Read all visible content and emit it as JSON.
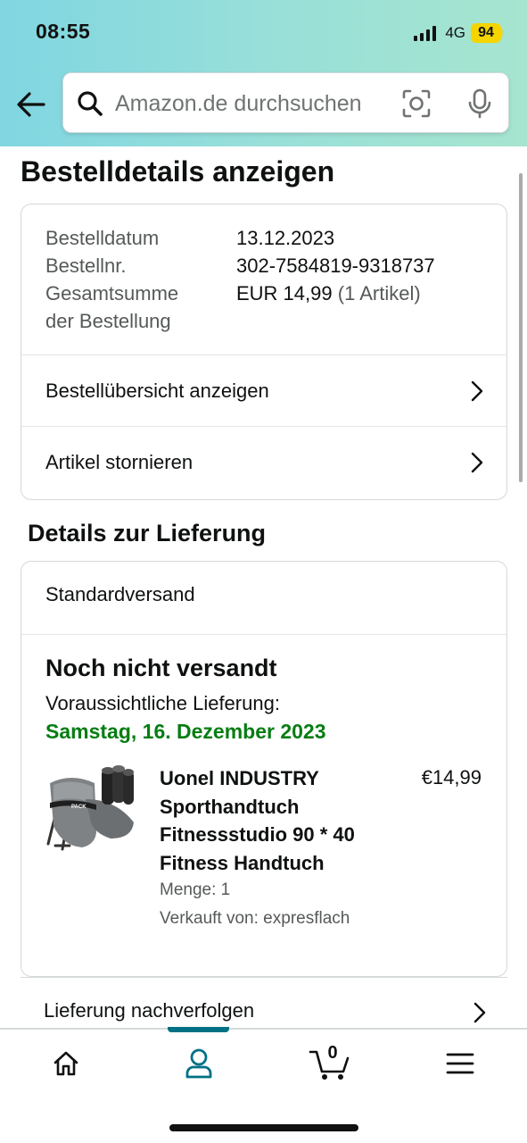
{
  "status_bar": {
    "time": "08:55",
    "network": "4G",
    "battery": "94",
    "battery_color": "#f5d400"
  },
  "search": {
    "placeholder": "Amazon.de durchsuchen",
    "icons": [
      "back-arrow-icon",
      "search-icon",
      "camera-icon",
      "mic-icon"
    ]
  },
  "page": {
    "title": "Bestelldetails anzeigen"
  },
  "order": {
    "date_label": "Bestelldatum",
    "date_value": "13.12.2023",
    "number_label": "Bestellnr.",
    "number_value": "302-7584819-9318737",
    "total_label_line1": "Gesamtsumme",
    "total_label_line2": "der Bestellung",
    "total_value": "EUR 14,99",
    "total_items": "(1 Artikel)",
    "links": [
      {
        "label": "Bestellübersicht anzeigen"
      },
      {
        "label": "Artikel stornieren"
      }
    ]
  },
  "delivery": {
    "section_title": "Details zur Lieferung",
    "method": "Standardversand",
    "status": "Noch nicht versandt",
    "expected_label": "Voraussichtliche Lieferung:",
    "expected_date": "Samstag, 16. Dezember 2023",
    "expected_date_color": "#067d12",
    "product": {
      "title": "Uonel INDUSTRY Sporthandtuch Fitnessstudio 90 * 40 Fitness Handtuch",
      "price": "€14,99",
      "quantity": "Menge: 1",
      "seller": "Verkauft von: expresflach",
      "image_brand_text": "PACK"
    },
    "track_label": "Lieferung nachverfolgen"
  },
  "bottom_nav": {
    "items": [
      {
        "name": "home",
        "icon": "home-icon"
      },
      {
        "name": "account",
        "icon": "user-icon",
        "active": true
      },
      {
        "name": "cart",
        "icon": "cart-icon",
        "count": "0"
      },
      {
        "name": "menu",
        "icon": "menu-icon"
      }
    ],
    "accent_color": "#007185"
  }
}
